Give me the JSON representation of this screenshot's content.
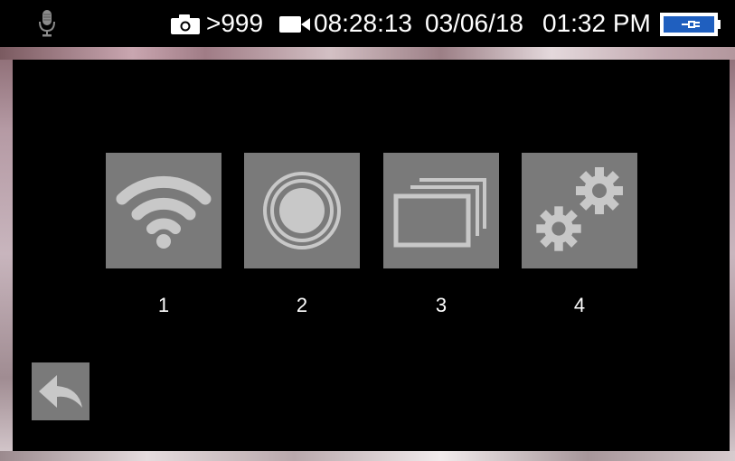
{
  "status_bar": {
    "photo_count": ">999",
    "video_time": "08:28:13",
    "date": "03/06/18",
    "time": "01:32 PM",
    "icons": {
      "mic": "microphone-icon",
      "camera": "camera-icon",
      "video": "videocam-icon",
      "battery": "battery-charging-icon"
    },
    "battery_color": "#1f5fbf"
  },
  "menu": {
    "items": [
      {
        "label": "1",
        "icon": "wifi-icon"
      },
      {
        "label": "2",
        "icon": "record-icon"
      },
      {
        "label": "3",
        "icon": "gallery-icon"
      },
      {
        "label": "4",
        "icon": "settings-gears-icon"
      }
    ],
    "tile_color": "#7a7a7a",
    "icon_color": "#c8c8c8"
  },
  "back": {
    "icon": "back-arrow-icon"
  }
}
